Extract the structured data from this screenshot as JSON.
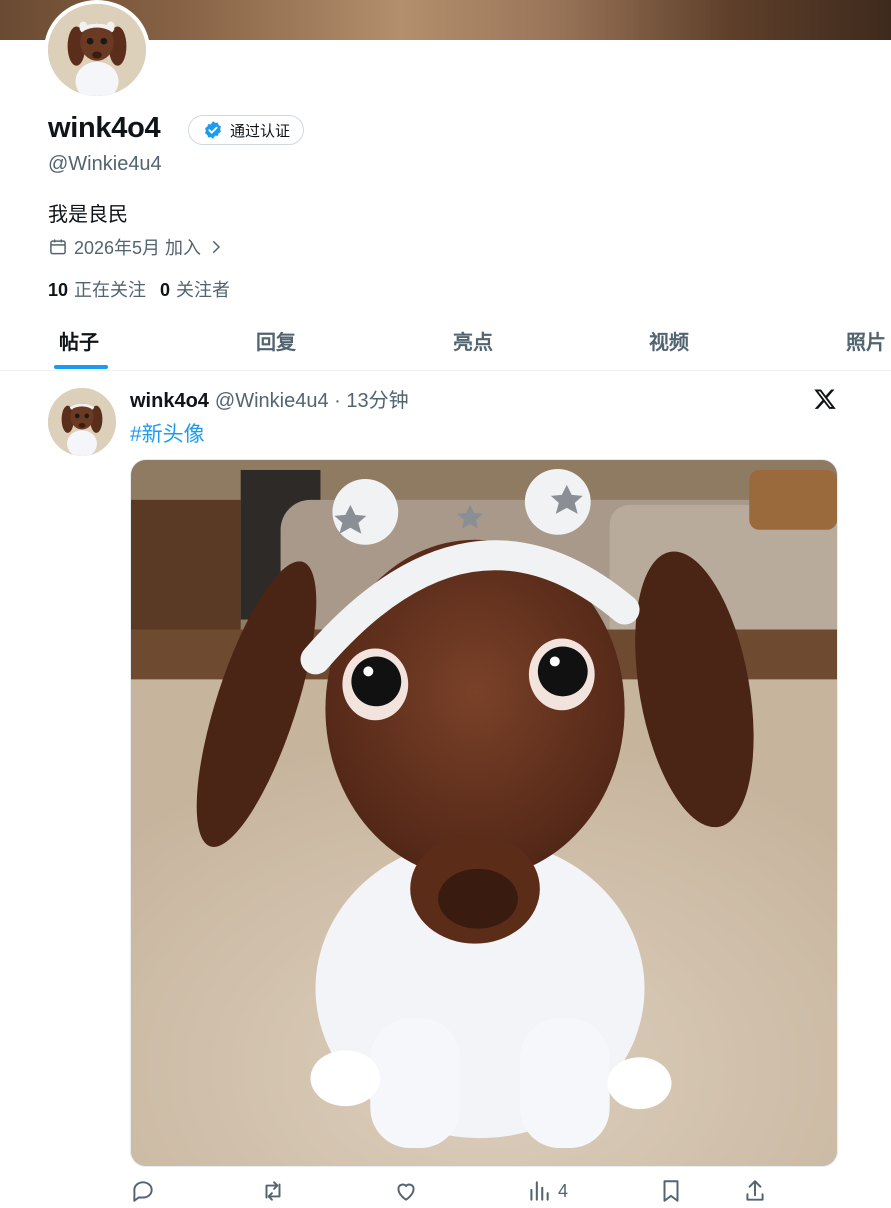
{
  "profile": {
    "display_name": "wink4o4",
    "verified_label": "通过认证",
    "handle": "@Winkie4u4",
    "bio": "我是良民",
    "joined": "2026年5月 加入",
    "following_count": "10",
    "following_label": "正在关注",
    "followers_count": "0",
    "followers_label": "关注者"
  },
  "tabs": [
    {
      "label": "帖子"
    },
    {
      "label": "回复"
    },
    {
      "label": "亮点"
    },
    {
      "label": "视频"
    },
    {
      "label": "照片"
    }
  ],
  "post": {
    "name": "wink4o4",
    "meta": "@Winkie4u4 · 13分钟",
    "hashtag": "#新头像",
    "views": "4"
  },
  "colors": {
    "accent": "#1d9bf0",
    "secondary_text": "#536471",
    "primary_text": "#0f1419"
  },
  "icons": [
    "calendar-icon",
    "chevron-right-icon",
    "verified-badge-icon",
    "x-logo-icon",
    "reply-icon",
    "repost-icon",
    "like-icon",
    "views-icon",
    "bookmark-icon",
    "share-icon"
  ]
}
